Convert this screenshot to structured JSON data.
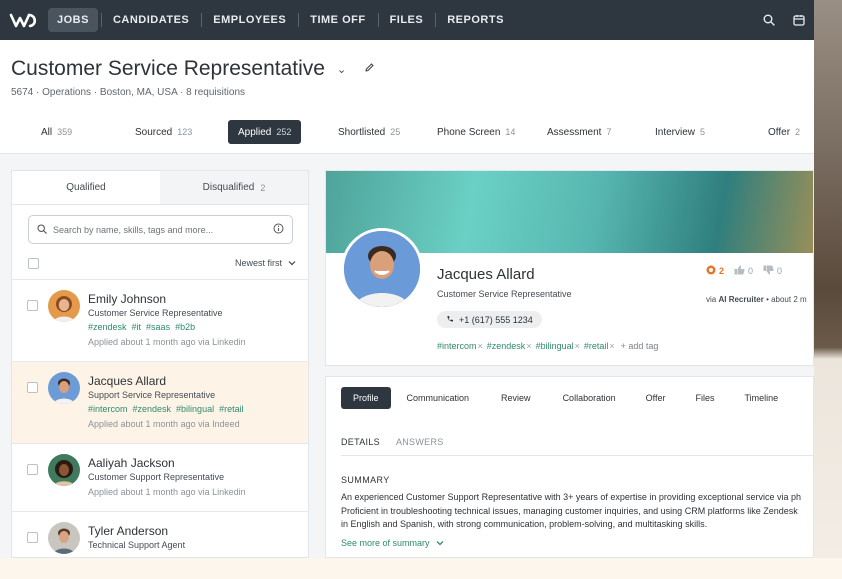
{
  "nav": {
    "items": [
      {
        "label": "JOBS",
        "active": true
      },
      {
        "label": "CANDIDATES"
      },
      {
        "label": "EMPLOYEES"
      },
      {
        "label": "TIME OFF"
      },
      {
        "label": "FILES"
      },
      {
        "label": "REPORTS"
      }
    ],
    "icons": [
      "logo-icon",
      "search-icon",
      "calendar-icon"
    ]
  },
  "job": {
    "title": "Customer Service Representative",
    "subline": "5674 · Operations · Boston, MA, USA · 8 requisitions"
  },
  "stages": [
    {
      "label": "All",
      "count": "359"
    },
    {
      "label": "Sourced",
      "count": "123"
    },
    {
      "label": "Applied",
      "count": "252",
      "active": true
    },
    {
      "label": "Shortlisted",
      "count": "25"
    },
    {
      "label": "Phone Screen",
      "count": "14"
    },
    {
      "label": "Assessment",
      "count": "7"
    },
    {
      "label": "Interview",
      "count": "5"
    },
    {
      "label": "Offer",
      "count": "2"
    }
  ],
  "list": {
    "tab_qualified": "Qualified",
    "tab_disqualified": "Disqualified",
    "disqualified_count": "2",
    "search_placeholder": "Search by name, skills, tags and more...",
    "sort_label": "Newest first",
    "candidates": [
      {
        "name": "Emily Johnson",
        "role": "Customer Service Representative",
        "tags": [
          "#zendesk",
          "#it",
          "#saas",
          "#b2b"
        ],
        "applied": "Applied about 1 month ago via Linkedin"
      },
      {
        "name": "Jacques Allard",
        "role": "Support Service Representative",
        "tags": [
          "#intercom",
          "#zendesk",
          "#bilingual",
          "#retail"
        ],
        "applied": "Applied about 1 month ago via Indeed"
      },
      {
        "name": "Aaliyah Jackson",
        "role": "Customer Support Representative",
        "tags": [],
        "applied": "Applied about 1 month ago via Linkedin"
      },
      {
        "name": "Tyler Anderson",
        "role": "Technical Support Agent",
        "tags": [],
        "applied": ""
      }
    ]
  },
  "profile": {
    "name": "Jacques Allard",
    "role": "Customer Service Representative",
    "phone": "+1 (617) 555 1234",
    "tags": [
      "#intercom",
      "#zendesk",
      "#bilingual",
      "#retail"
    ],
    "add_tag": "+ add tag",
    "score_count": "2",
    "likes": "0",
    "dislikes": "0",
    "via_prefix": "via",
    "via_source": "AI Recruiter",
    "via_suffix": "• about 2 m"
  },
  "detail": {
    "tabs": [
      "Profile",
      "Communication",
      "Review",
      "Collaboration",
      "Offer",
      "Files",
      "Timeline"
    ],
    "subtabs": [
      "DETAILS",
      "ANSWERS"
    ],
    "summary_heading": "SUMMARY",
    "summary_lines": [
      "An experienced Customer Support Representative with 3+ years of expertise in providing exceptional service via ph",
      "Proficient in troubleshooting technical issues, managing customer inquiries, and using CRM platforms like Zendesk",
      "in English and Spanish, with strong communication, problem-solving, and multitasking skills."
    ],
    "see_more": "See more of summary"
  },
  "colors": {
    "nav_bg": "#2e3740",
    "accent_green": "#2f8a6e",
    "selected_row": "#fdf4e7",
    "score_orange": "#e8742a"
  }
}
